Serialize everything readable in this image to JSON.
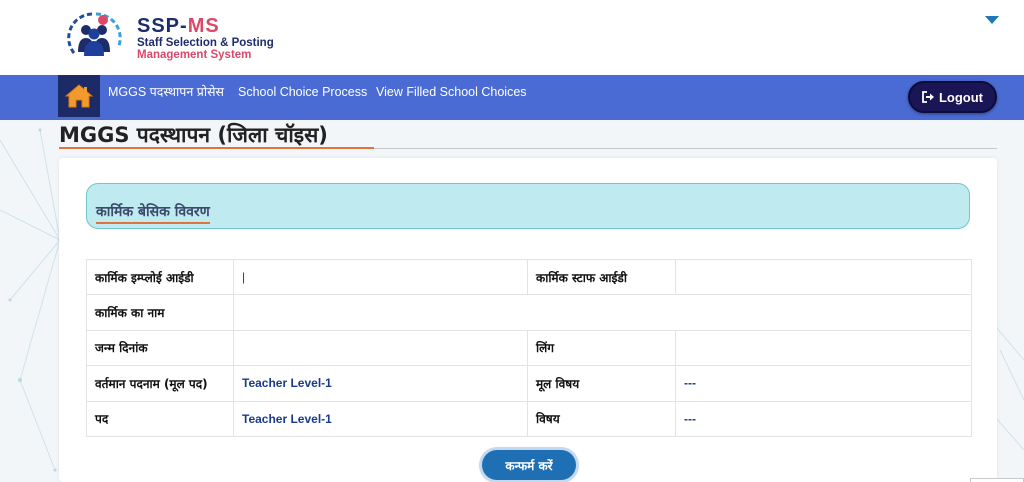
{
  "brand": {
    "title_main": "SSP-",
    "title_accent": "MS",
    "subtitle_line1": "Staff Selection & Posting",
    "subtitle_line2": "Management System"
  },
  "nav": {
    "items": [
      {
        "label": "MGGS पदस्थापन प्रोसेस"
      },
      {
        "label": "School Choice Process"
      },
      {
        "label": "View Filled School Choices"
      }
    ],
    "logout_label": "Logout"
  },
  "page": {
    "title": "MGGS पदस्थापन (जिला चॉइस)"
  },
  "section": {
    "title": "कार्मिक बेसिक विवरण"
  },
  "details": {
    "rows": [
      {
        "label1": "कार्मिक इम्प्लोई आईडी",
        "value1": "|",
        "label2": "कार्मिक स्टाफ आईडी",
        "value2": ""
      },
      {
        "label1": "कार्मिक का नाम",
        "value1": ""
      },
      {
        "label1": "जन्म दिनांक",
        "value1": "",
        "label2": "लिंग",
        "value2": ""
      },
      {
        "label1": "वर्तमान पदनाम (मूल पद)",
        "value1": "Teacher Level-1",
        "label2": "मूल विषय",
        "value2": "---"
      },
      {
        "label1": "पद",
        "value1": "Teacher Level-1",
        "label2": "विषय",
        "value2": "---"
      }
    ]
  },
  "actions": {
    "confirm_label": "कन्फर्म करें"
  },
  "colors": {
    "navbar": "#4a6bd3",
    "home_button": "#1c2a66",
    "logout_button": "#1a1656",
    "section_bg": "#bfeaf0",
    "accent_underline": "#e0733a",
    "value_text": "#1a3a8c",
    "confirm_button": "#1f6fb5"
  },
  "icons": {
    "home": "home-icon",
    "logout": "sign-out-icon",
    "user_menu": "caret-down-icon"
  }
}
